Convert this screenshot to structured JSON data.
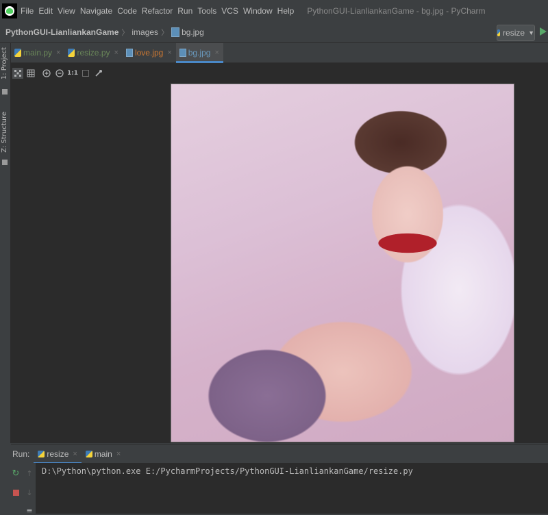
{
  "menu": {
    "items": [
      "File",
      "Edit",
      "View",
      "Navigate",
      "Code",
      "Refactor",
      "Run",
      "Tools",
      "VCS",
      "Window",
      "Help"
    ],
    "window_title": "PythonGUI-LianliankanGame - bg.jpg - PyCharm"
  },
  "navbar": {
    "project": "PythonGUI-LianliankanGame",
    "folder": "images",
    "file": "bg.jpg",
    "run_config": "resize"
  },
  "left_strip": {
    "project_tab": "1: Project",
    "structure_tab": "Z: Structure"
  },
  "tabs": [
    {
      "label": "main.py",
      "color": "#6a8759",
      "type": "py"
    },
    {
      "label": "resize.py",
      "color": "#6a8759",
      "type": "py"
    },
    {
      "label": "love.jpg",
      "color": "#cc7832",
      "type": "img"
    },
    {
      "label": "bg.jpg",
      "color": "#6897bb",
      "type": "img"
    }
  ],
  "image_toolbar": {
    "icons": [
      "grid-toggle-icon",
      "chessboard-icon",
      "zoom-in-icon",
      "zoom-out-icon",
      "actual-size-icon",
      "fit-icon",
      "color-picker-icon"
    ],
    "actual_size_label": "1:1"
  },
  "run_panel": {
    "label": "Run:",
    "tabs": [
      "resize",
      "main"
    ],
    "command": "D:\\Python\\python.exe E:/PycharmProjects/PythonGUI-LianliankanGame/resize.py"
  },
  "colors": {
    "accent": "#4a88c7",
    "run_green": "#59a869",
    "stop_red": "#c75450"
  }
}
